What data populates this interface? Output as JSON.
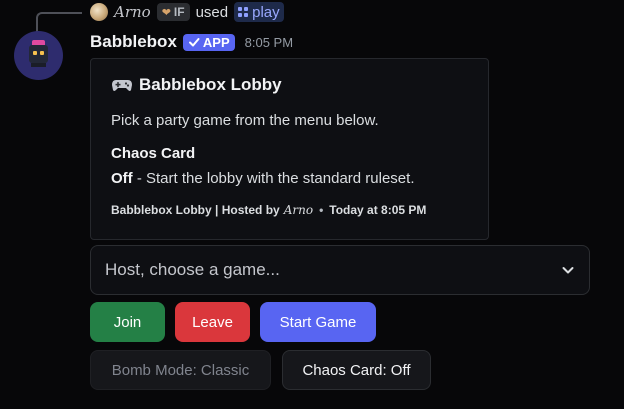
{
  "reply": {
    "user_name": "𝐴𝑟𝑛𝑜",
    "tag": "IF",
    "verb": "used",
    "command": "play"
  },
  "message": {
    "bot_name": "Babblebox",
    "badge": "APP",
    "timestamp": "8:05 PM"
  },
  "embed": {
    "title": "Babblebox Lobby",
    "description": "Pick a party game from the menu below.",
    "field_name": "Chaos Card",
    "field_value_bold": "Off",
    "field_value_rest": " - Start the lobby with the standard ruleset.",
    "footer_prefix": "Babblebox Lobby | Hosted by",
    "footer_user": "𝐴𝑟𝑛𝑜",
    "footer_dot": "•",
    "footer_time": "Today at 8:05 PM"
  },
  "select": {
    "placeholder": "Host, choose a game..."
  },
  "buttons": {
    "join": "Join",
    "leave": "Leave",
    "start": "Start Game",
    "bomb_mode": "Bomb Mode: Classic",
    "chaos_card": "Chaos Card: Off"
  },
  "colors": {
    "success": "#248046",
    "danger": "#da373c",
    "primary": "#5865f2",
    "secondary": "#16171b"
  },
  "icons": {
    "reply_avatar": "avatar-icon",
    "command": "command-grid-icon",
    "badge": "check-icon",
    "embed_title": "game-controller-icon",
    "select": "chevron-down-icon"
  }
}
